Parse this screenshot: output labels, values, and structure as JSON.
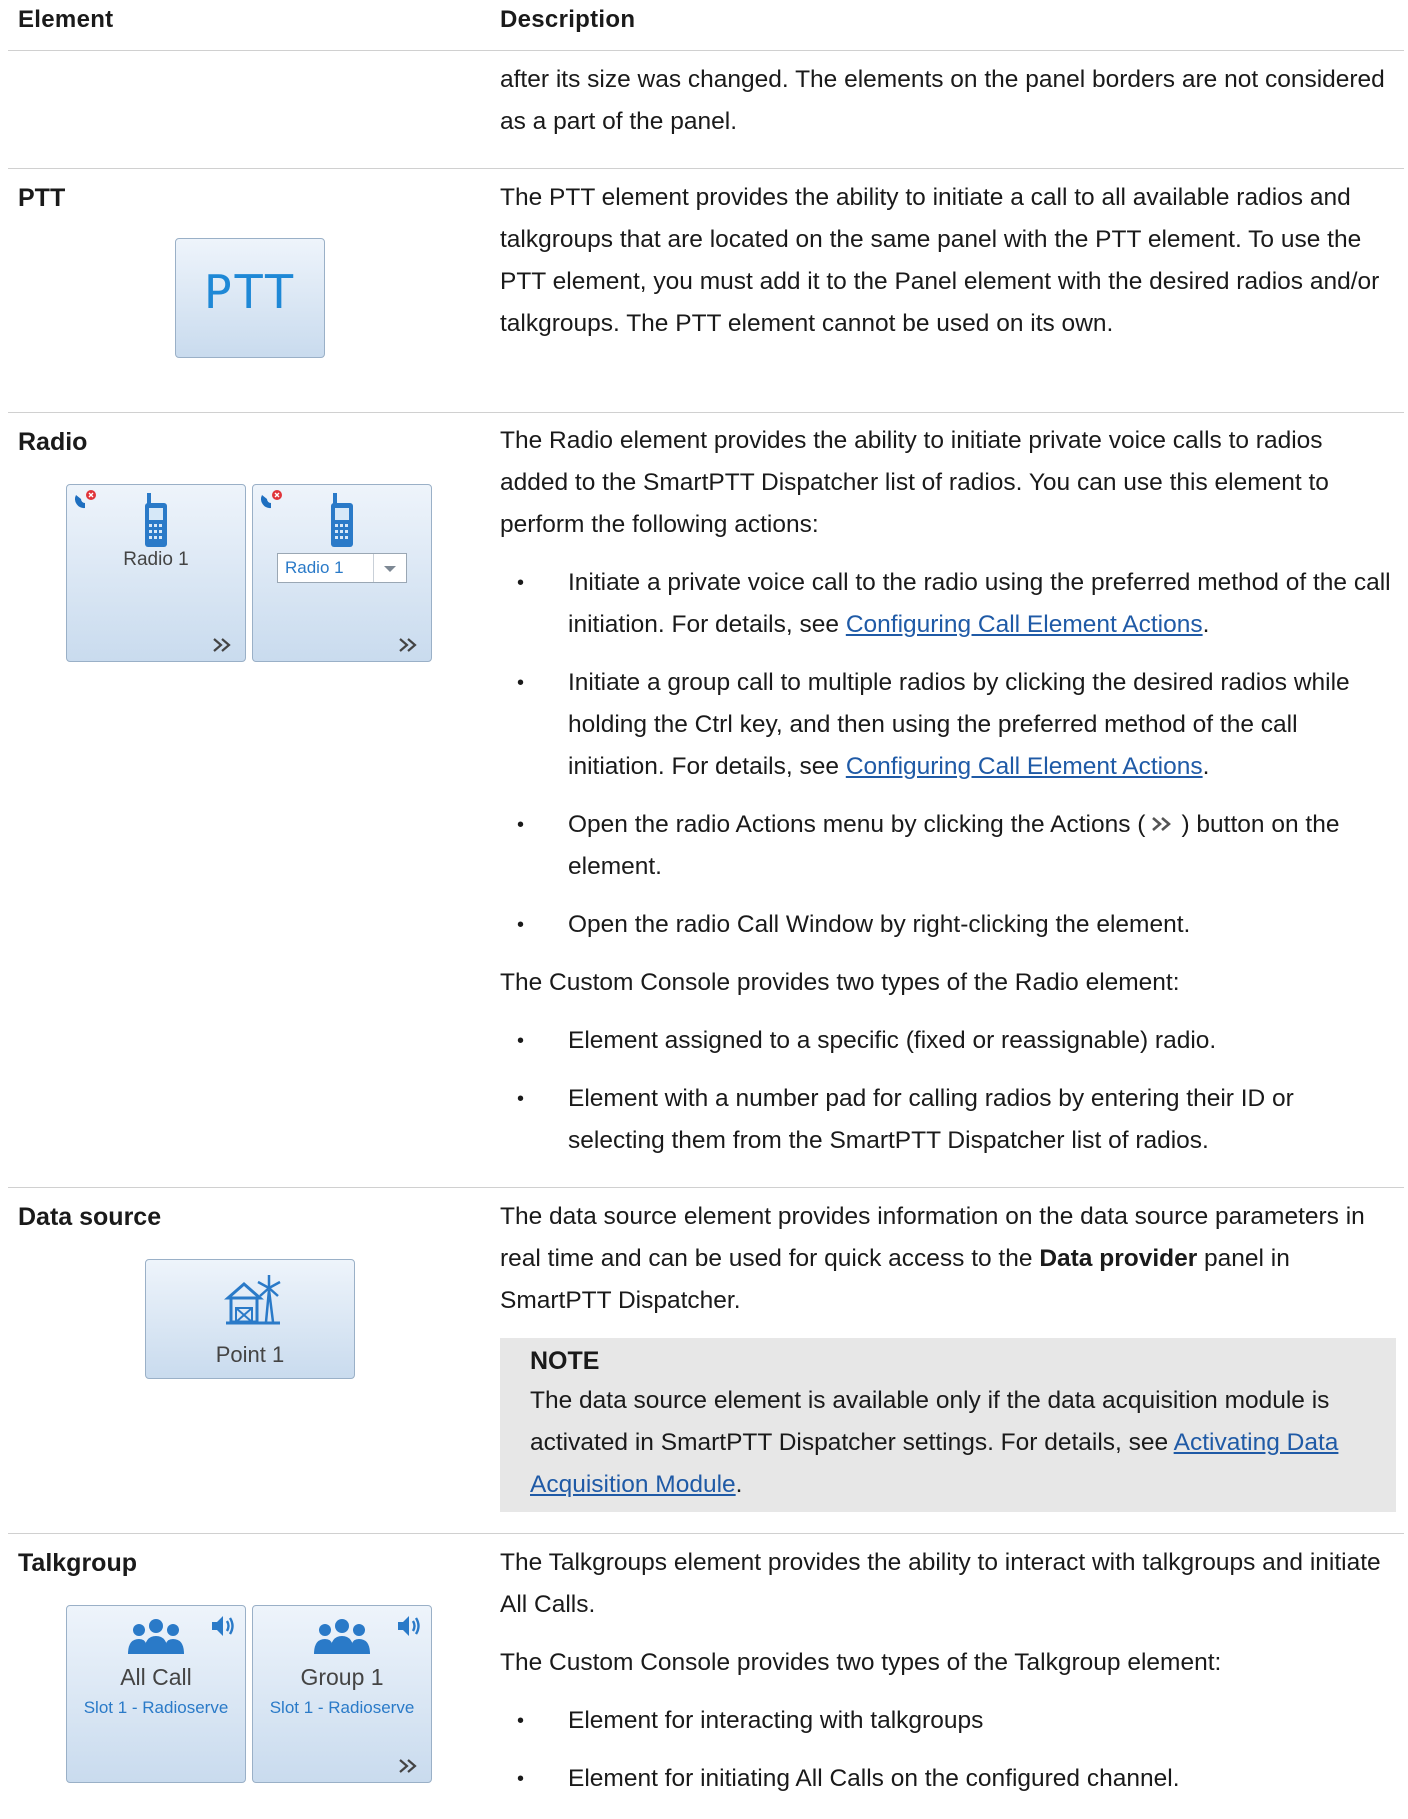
{
  "header": {
    "col_element": "Element",
    "col_description": "Description"
  },
  "panel_continuation": "after its size was changed. The elements on the panel borders are not considered as a part of the panel.",
  "ptt": {
    "title": "PTT",
    "button_label": "PTT",
    "description": "The PTT element provides the ability to initiate a call to all available radios and talkgroups that are located on the same panel with the PTT element. To use the PTT element, you must add it to the Panel element with the desired radios and/or talkgroups. The PTT element cannot be used on its own."
  },
  "radio": {
    "title": "Radio",
    "tile1_label": "Radio 1",
    "tile2_combo_value": "Radio 1",
    "intro": "The Radio element provides the ability to initiate private voice calls to radios added to the SmartPTT Dispatcher list of radios. You can use this element to perform the following actions:",
    "b1_pre": "Initiate a private voice call to the radio using the preferred method of the call initiation. For details, see ",
    "b1_link": "Configuring Call Element Actions",
    "b1_post": ".",
    "b2_pre": "Initiate a group call to multiple radios by clicking the desired radios while holding the Ctrl key, and then using the preferred method of the call initiation. For details, see ",
    "b2_link": "Configuring Call Element Actions",
    "b2_post": ".",
    "b3_pre": "Open the radio Actions menu by clicking the Actions (",
    "b3_post": ") button on the element.",
    "b4": "Open the radio Call Window by right-clicking the element.",
    "types_intro": "The Custom Console provides two types of the Radio element:",
    "t1": "Element assigned to a specific (fixed or reassignable) radio.",
    "t2": "Element with a number pad for calling radios by entering their ID or selecting them from the SmartPTT Dispatcher list of radios."
  },
  "datasource": {
    "title": "Data source",
    "tile_label": "Point 1",
    "desc_pre": "The data source element provides information on the data source parameters in real time and can be used for quick access to the ",
    "desc_bold": "Data provider",
    "desc_post": " panel in SmartPTT Dispatcher.",
    "note_title": "NOTE",
    "note_pre": "The data source element is available only if the data acquisition module is activated in SmartPTT Dispatcher settings. For details, see ",
    "note_link": "Activating Data Acquisition Module",
    "note_post": "."
  },
  "talkgroup": {
    "title": "Talkgroup",
    "tile1_label": "All Call",
    "tile1_sub": "Slot 1 - Radioserve",
    "tile2_label": "Group 1",
    "tile2_sub": "Slot 1 - Radioserve",
    "intro": "The Talkgroups element provides the ability to interact with talkgroups and initiate All Calls.",
    "types_intro": "The Custom Console provides two types of the Talkgroup element:",
    "t1": "Element for interacting with talkgroups",
    "t2": "Element for initiating All Calls on the configured channel."
  },
  "colors": {
    "link": "#1f5aa6",
    "tile_accent": "#1e88d6",
    "note_bg": "#e7e7e7"
  }
}
